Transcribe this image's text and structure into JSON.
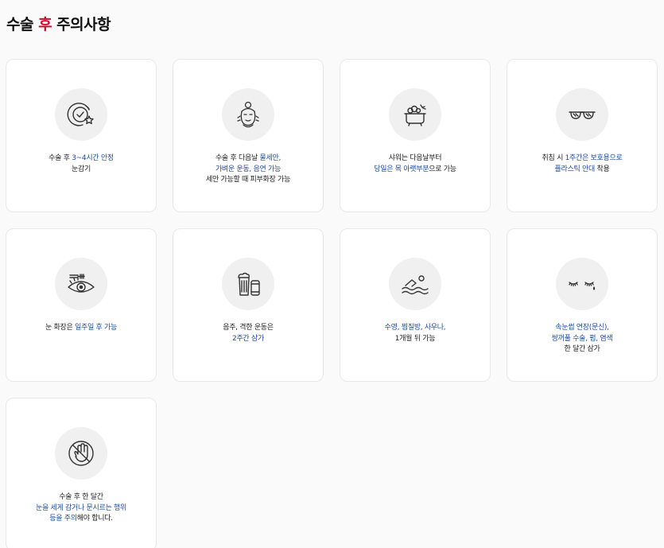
{
  "page": {
    "title_pre": "수술 ",
    "title_accent": "후",
    "title_post": " 주의사항",
    "accent_color": "#c8102e",
    "highlight_color": "#1b4a9c"
  },
  "cards": [
    {
      "icon": "clock-star-icon",
      "lines": [
        [
          {
            "t": "수술 후 ",
            "hl": false
          },
          {
            "t": "3~4시간 안정",
            "hl": true
          }
        ],
        [
          {
            "t": "눈감기",
            "hl": false
          }
        ]
      ]
    },
    {
      "icon": "face-wash-icon",
      "lines": [
        [
          {
            "t": "수술 후 다음날 ",
            "hl": false
          },
          {
            "t": "물세안,",
            "hl": true
          }
        ],
        [
          {
            "t": "가벼운 운동, 음연 가능",
            "hl": true
          }
        ],
        [
          {
            "t": "세안 가능할 때 피부화장 가능",
            "hl": false
          }
        ]
      ]
    },
    {
      "icon": "bath-tub-icon",
      "lines": [
        [
          {
            "t": "샤워는 다음날부터",
            "hl": false
          }
        ],
        [
          {
            "t": "당일은 목 아랫부분",
            "hl": true
          },
          {
            "t": "으로 가능",
            "hl": false
          }
        ]
      ]
    },
    {
      "icon": "sunglasses-icon",
      "lines": [
        [
          {
            "t": "취침 시 ",
            "hl": false
          },
          {
            "t": "1주간은 보호용으로",
            "hl": true
          }
        ],
        [
          {
            "t": "플라스틱 안대",
            "hl": true
          },
          {
            "t": " 착용",
            "hl": false
          }
        ]
      ]
    },
    {
      "icon": "eye-mascara-icon",
      "lines": [
        [
          {
            "t": "눈 화장은 ",
            "hl": false
          },
          {
            "t": "일주일 후 가능",
            "hl": true
          }
        ]
      ]
    },
    {
      "icon": "beer-can-icon",
      "lines": [
        [
          {
            "t": "음주, 격한 운동은",
            "hl": false
          }
        ],
        [
          {
            "t": "2주간 삼가",
            "hl": true
          }
        ]
      ]
    },
    {
      "icon": "swimming-icon",
      "lines": [
        [
          {
            "t": "수영, 찜질방, 사우나,",
            "hl": true
          }
        ],
        [
          {
            "t": "1개월 뒤 가능",
            "hl": false
          }
        ]
      ]
    },
    {
      "icon": "closed-eyes-icon",
      "lines": [
        [
          {
            "t": "속눈썹 연장(문신),",
            "hl": true
          }
        ],
        [
          {
            "t": "쌍꺼풀 수술, 펌, 염색",
            "hl": true
          }
        ],
        [
          {
            "t": "한 달간 삼가",
            "hl": false
          }
        ]
      ]
    },
    {
      "icon": "no-hand-icon",
      "lines": [
        [
          {
            "t": "수술 후 한 달간",
            "hl": false
          }
        ],
        [
          {
            "t": "눈을 세게 감거나 문시르는 행위",
            "hl": true
          }
        ],
        [
          {
            "t": "등을 주의",
            "hl": true
          },
          {
            "t": "해야 합니다.",
            "hl": false
          }
        ]
      ]
    }
  ]
}
